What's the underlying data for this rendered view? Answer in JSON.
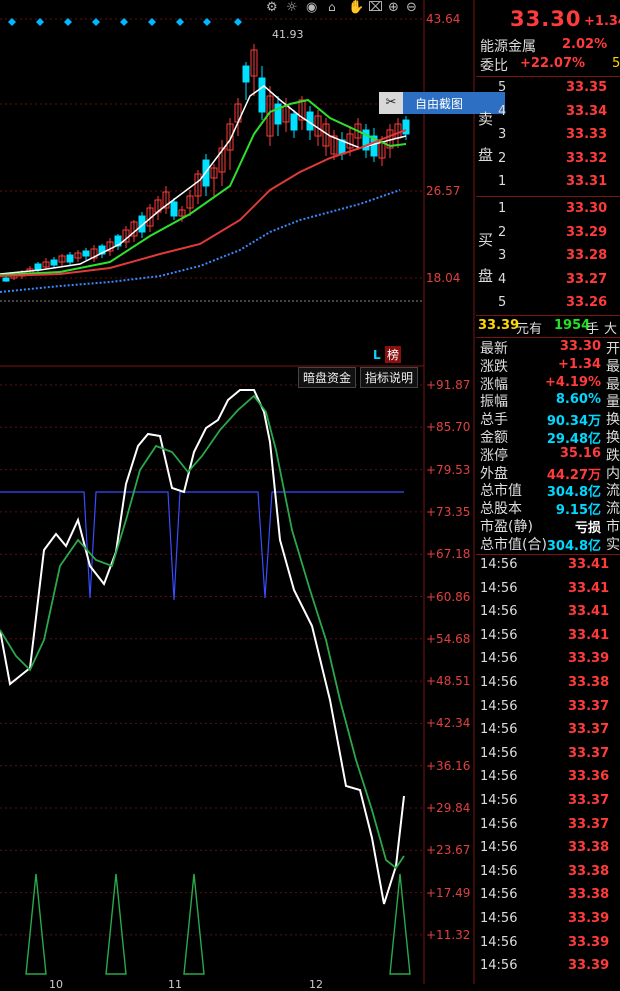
{
  "chart_data": [
    {
      "type": "candlestick",
      "panel": "main",
      "y_ticks": [
        "43.64",
        "26.57",
        "18.04"
      ],
      "annotations": [
        "41.93"
      ],
      "indicator_series": [
        "MA-white",
        "MA-green",
        "MA-red",
        "MA-blue-dotted"
      ]
    },
    {
      "type": "line",
      "panel": "indicator",
      "y_ticks": [
        "+91.87",
        "+85.70",
        "+79.53",
        "+73.35",
        "+67.18",
        "+60.86",
        "+54.68",
        "+48.51",
        "+42.34",
        "+36.16",
        "+29.84",
        "+23.67",
        "+17.49",
        "+11.32"
      ],
      "x_ticks": [
        "10",
        "11",
        "12"
      ]
    }
  ],
  "toolbar": {
    "icons": [
      "settings-icon",
      "bulb-icon",
      "eye-icon",
      "basket-icon",
      "hand-icon",
      "lock-icon",
      "zoom-in-icon",
      "zoom-out-icon"
    ],
    "screenshot_label": "自由截图"
  },
  "indicator_bar": {
    "l_badge": "L",
    "bang_badge": "榜",
    "btn_dark_funds": "暗盘资金",
    "btn_indicator_help": "指标说明"
  },
  "quote": {
    "price": "33.30",
    "change": "+1.34",
    "sector": "能源金属",
    "sector_pct": "2.02%",
    "commission_label": "委比",
    "commission_value": "+22.07%",
    "commission_extra": "5"
  },
  "order_book": {
    "sell_label_1": "卖",
    "sell_label_2": "盘",
    "buy_label_1": "买",
    "buy_label_2": "盘",
    "sell": [
      {
        "level": "5",
        "price": "33.35"
      },
      {
        "level": "4",
        "price": "33.34"
      },
      {
        "level": "3",
        "price": "33.33"
      },
      {
        "level": "2",
        "price": "33.32"
      },
      {
        "level": "1",
        "price": "33.31"
      }
    ],
    "buy": [
      {
        "level": "1",
        "price": "33.30"
      },
      {
        "level": "2",
        "price": "33.29"
      },
      {
        "level": "3",
        "price": "33.28"
      },
      {
        "level": "4",
        "price": "33.27"
      },
      {
        "level": "5",
        "price": "33.26"
      }
    ]
  },
  "last_trade": {
    "price": "33.39",
    "unit": "元有",
    "volume": "1954",
    "volume_unit": "手",
    "suffix": "大"
  },
  "stats": [
    {
      "label": "最新",
      "value": "33.30",
      "value_color": "red",
      "edge": "开"
    },
    {
      "label": "涨跌",
      "value": "+1.34",
      "value_color": "red",
      "edge": "最"
    },
    {
      "label": "涨幅",
      "value": "+4.19%",
      "value_color": "red",
      "edge": "最"
    },
    {
      "label": "振幅",
      "value": "8.60%",
      "value_color": "cyan",
      "edge": "量"
    },
    {
      "label": "总手",
      "value": "90.34万",
      "value_color": "cyan",
      "edge": "换"
    },
    {
      "label": "金额",
      "value": "29.48亿",
      "value_color": "cyan",
      "edge": "换"
    },
    {
      "label": "涨停",
      "value": "35.16",
      "value_color": "red",
      "edge": "跌"
    },
    {
      "label": "外盘",
      "value": "44.27万",
      "value_color": "red",
      "edge": "内"
    },
    {
      "label": "总市值",
      "value": "304.8亿",
      "value_color": "cyan",
      "edge": "流"
    },
    {
      "label": "总股本",
      "value": "9.15亿",
      "value_color": "cyan",
      "edge": "流"
    },
    {
      "label": "市盈(静)",
      "value": "亏损",
      "value_color": "white",
      "edge": "市"
    },
    {
      "label": "总市值(合)",
      "value": "304.8亿",
      "value_color": "cyan",
      "edge": "实"
    }
  ],
  "ticks": [
    {
      "time": "14:56",
      "price": "33.41"
    },
    {
      "time": "14:56",
      "price": "33.41"
    },
    {
      "time": "14:56",
      "price": "33.41"
    },
    {
      "time": "14:56",
      "price": "33.41"
    },
    {
      "time": "14:56",
      "price": "33.39"
    },
    {
      "time": "14:56",
      "price": "33.38"
    },
    {
      "time": "14:56",
      "price": "33.37"
    },
    {
      "time": "14:56",
      "price": "33.37"
    },
    {
      "time": "14:56",
      "price": "33.37"
    },
    {
      "time": "14:56",
      "price": "33.36"
    },
    {
      "time": "14:56",
      "price": "33.37"
    },
    {
      "time": "14:56",
      "price": "33.37"
    },
    {
      "time": "14:56",
      "price": "33.38"
    },
    {
      "time": "14:56",
      "price": "33.38"
    },
    {
      "time": "14:56",
      "price": "33.38"
    },
    {
      "time": "14:56",
      "price": "33.39"
    },
    {
      "time": "14:56",
      "price": "33.39"
    },
    {
      "time": "14:56",
      "price": "33.39"
    }
  ]
}
